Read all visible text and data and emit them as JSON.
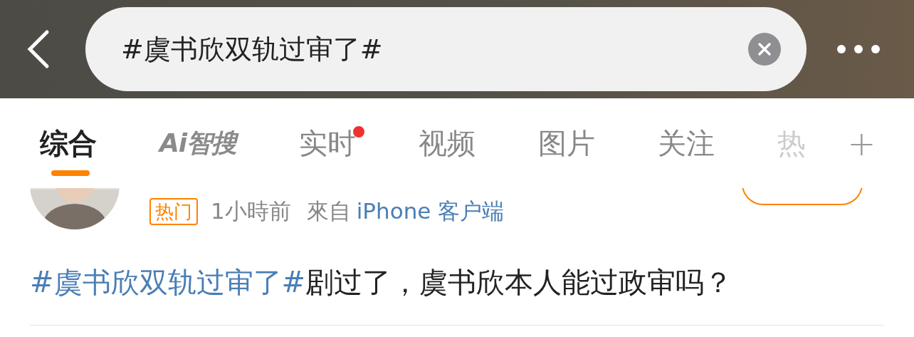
{
  "search": {
    "value": "#虞书欣双轨过审了#"
  },
  "tabs": [
    {
      "label": "综合",
      "kind": "text",
      "selected": true,
      "dot": false,
      "faded": false
    },
    {
      "label": "Ai智搜",
      "kind": "logo",
      "selected": false,
      "dot": false,
      "faded": false
    },
    {
      "label": "实时",
      "kind": "text",
      "selected": false,
      "dot": true,
      "faded": false
    },
    {
      "label": "视频",
      "kind": "text",
      "selected": false,
      "dot": false,
      "faded": false
    },
    {
      "label": "图片",
      "kind": "text",
      "selected": false,
      "dot": false,
      "faded": false
    },
    {
      "label": "关注",
      "kind": "text",
      "selected": false,
      "dot": false,
      "faded": false
    },
    {
      "label": "热",
      "kind": "text",
      "selected": false,
      "dot": false,
      "faded": true
    }
  ],
  "add_tab": {
    "label": "+"
  },
  "post": {
    "badge": "热门",
    "time": "1小時前",
    "source_prefix": "來自",
    "source": "iPhone 客户端",
    "topic": "#虞书欣双轨过审了#",
    "text": "剧过了，虞书欣本人能过政审吗？"
  }
}
